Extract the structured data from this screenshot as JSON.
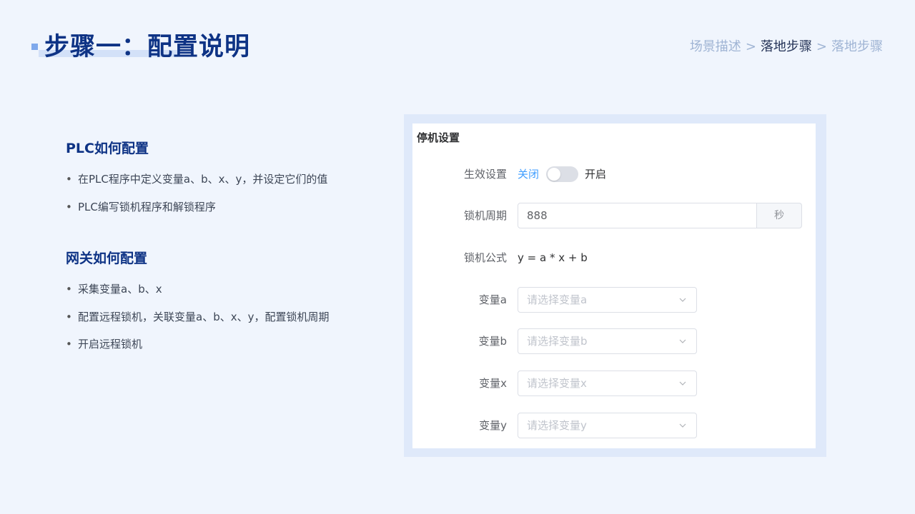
{
  "header": {
    "title": "步骤一：配置说明",
    "breadcrumb": {
      "items": [
        "场景描述",
        "落地步骤",
        "落地步骤"
      ],
      "separator": ">",
      "current_index": 1
    }
  },
  "left": {
    "sections": [
      {
        "heading": "PLC如何配置",
        "bullets": [
          "在PLC程序中定义变量a、b、x、y，并设定它们的值",
          "PLC编写锁机程序和解锁程序"
        ]
      },
      {
        "heading": "网关如何配置",
        "bullets": [
          "采集变量a、b、x",
          "配置远程锁机，关联变量a、b、x、y，配置锁机周期",
          "开启远程锁机"
        ]
      }
    ]
  },
  "panel": {
    "title": "停机设置",
    "effect": {
      "label": "生效设置",
      "off_text": "关闭",
      "on_text": "开启",
      "enabled": false
    },
    "period": {
      "label": "锁机周期",
      "value": "888",
      "unit": "秒"
    },
    "formula": {
      "label": "锁机公式",
      "value": "y = a * x + b"
    },
    "selects": [
      {
        "label": "变量a",
        "placeholder": "请选择变量a"
      },
      {
        "label": "变量b",
        "placeholder": "请选择变量b"
      },
      {
        "label": "变量x",
        "placeholder": "请选择变量x"
      },
      {
        "label": "变量y",
        "placeholder": "请选择变量y"
      }
    ]
  },
  "colors": {
    "accent": "#0e3385",
    "link": "#409eff",
    "background": "#f0f5fd"
  },
  "icons": {
    "select_arrow": "chevron-down-icon"
  }
}
